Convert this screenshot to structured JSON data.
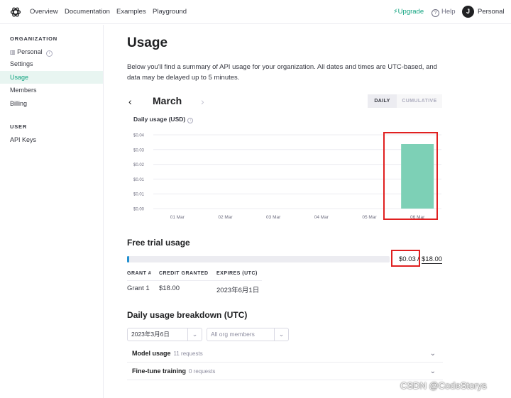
{
  "nav": {
    "links": [
      "Overview",
      "Documentation",
      "Examples",
      "Playground"
    ],
    "upgrade": "Upgrade",
    "help": "Help",
    "avatar_initial": "J",
    "account": "Personal"
  },
  "sidebar": {
    "org_heading": "ORGANIZATION",
    "org_name": "Personal",
    "org_items": [
      "Settings",
      "Usage",
      "Members",
      "Billing"
    ],
    "active_item": "Usage",
    "user_heading": "USER",
    "user_items": [
      "API Keys"
    ]
  },
  "page": {
    "title": "Usage",
    "intro": "Below you'll find a summary of API usage for your organization. All dates and times are UTC-based, and data may be delayed up to 5 minutes."
  },
  "period": {
    "month": "March",
    "prev": "‹",
    "next": "›",
    "toggle_daily": "DAILY",
    "toggle_cumulative": "CUMULATIVE",
    "selected": "DAILY"
  },
  "chart_data": {
    "type": "bar",
    "title": "Daily usage (USD)",
    "categories": [
      "01 Mar",
      "02 Mar",
      "03 Mar",
      "04 Mar",
      "05 Mar",
      "06 Mar"
    ],
    "values": [
      0,
      0,
      0,
      0,
      0,
      0.035
    ],
    "y_tick_labels": [
      "$0.04",
      "$0.03",
      "$0.02",
      "$0.01",
      "$0.01",
      "$0.00"
    ],
    "ylim": [
      0,
      0.04
    ],
    "grid": true,
    "bar_color": "#7dd0b6"
  },
  "free_trial": {
    "heading": "Free trial usage",
    "used": "$0.03",
    "separator": "/",
    "total": "$18.00",
    "used_fraction": 0.0017,
    "bar_color": "#2190d0",
    "columns": [
      "GRANT #",
      "CREDIT GRANTED",
      "EXPIRES (UTC)"
    ],
    "rows": [
      [
        "Grant 1",
        "$18.00",
        "2023年6月1日"
      ]
    ]
  },
  "breakdown": {
    "heading": "Daily usage breakdown (UTC)",
    "date_value": "2023年3月6日",
    "members_placeholder": "All org members",
    "sections": [
      {
        "label": "Model usage",
        "count": "11 requests"
      },
      {
        "label": "Fine-tune training",
        "count": "0 requests"
      }
    ]
  },
  "watermark": "CSDN @CodeStorys"
}
